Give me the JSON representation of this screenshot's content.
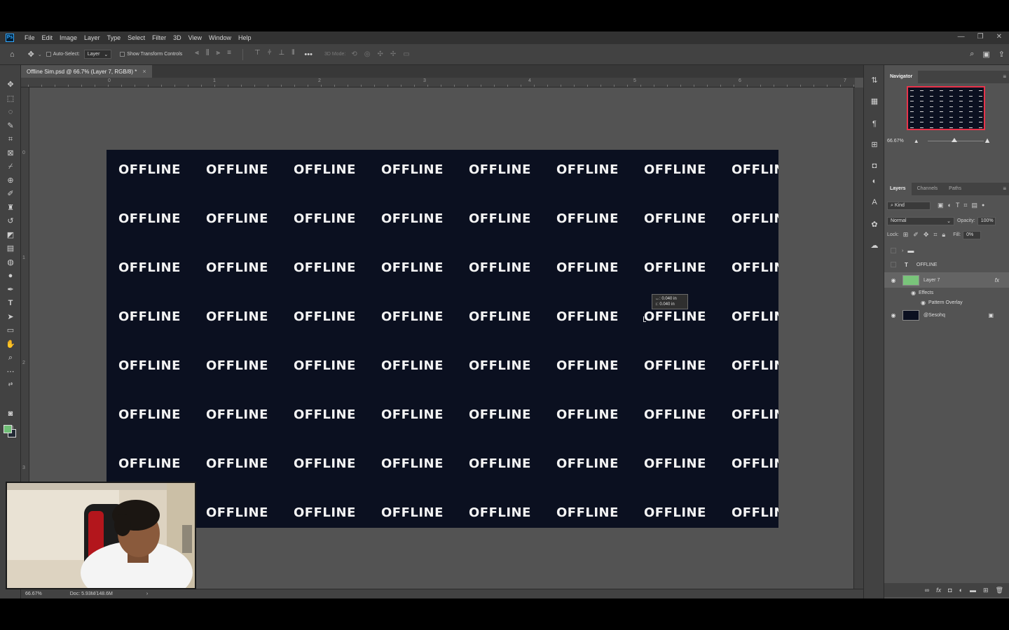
{
  "app": {
    "logo": "Ps",
    "menu": [
      "File",
      "Edit",
      "Image",
      "Layer",
      "Type",
      "Select",
      "Filter",
      "3D",
      "View",
      "Window",
      "Help"
    ],
    "window_controls": {
      "minimize": "—",
      "restore": "❐",
      "close": "✕"
    }
  },
  "options_bar": {
    "auto_select_label": "Auto-Select:",
    "auto_select_target": "Layer",
    "show_transform_label": "Show Transform Controls",
    "mode_label": "3D Mode:"
  },
  "document": {
    "tab_title": "Offline Sim.psd @ 66.7% (Layer 7, RGB/8) *",
    "close_glyph": "×",
    "ruler_h_labels": [
      "0",
      "1",
      "2",
      "3",
      "4",
      "5",
      "6",
      "7"
    ],
    "ruler_v_labels": [
      "0",
      "1",
      "2",
      "3"
    ],
    "canvas_color": "#0b1020",
    "pattern_word": "OFFLINE",
    "pattern_word_cropped": "OFFLIN",
    "tooltip_line1": "↔:  0.040 in",
    "tooltip_line2": "↕:  0.040 in"
  },
  "status": {
    "zoom": "66.67%",
    "doc_size": "Doc: 5.93M/148.6M",
    "arrow": "›"
  },
  "navigator": {
    "title": "Navigator",
    "zoom": "66.67%"
  },
  "layers_panel": {
    "tabs": [
      "Layers",
      "Channels",
      "Paths"
    ],
    "filter_kind": "Kind",
    "blend_mode": "Normal",
    "opacity_label": "Opacity:",
    "opacity_value": "100%",
    "lock_label": "Lock:",
    "fill_label": "Fill:",
    "fill_value": "0%",
    "layers": [
      {
        "name": "",
        "type": "group"
      },
      {
        "name": "OFFLINE",
        "type": "text"
      },
      {
        "name": "Layer 7",
        "type": "pixel",
        "thumb_color": "#79c47a",
        "fx": "fx"
      },
      {
        "name": "Effects",
        "type": "effects"
      },
      {
        "name": "Pattern Overlay",
        "type": "effect"
      },
      {
        "name": "@Sesohq",
        "type": "pixel",
        "thumb_color": "#0b1020"
      }
    ]
  },
  "colors": {
    "foreground": "#6fbf76",
    "background": "#222a35",
    "accent": "#31a8ff",
    "navigator_frame": "#e8334a"
  }
}
